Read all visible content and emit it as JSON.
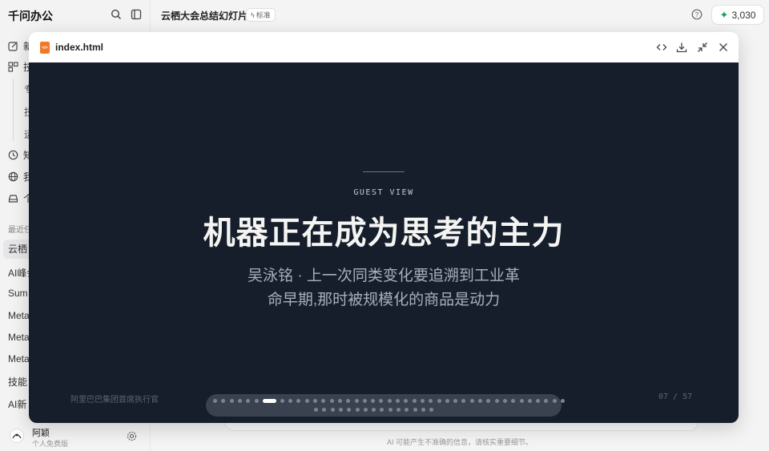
{
  "app": {
    "brand": "千问办公",
    "doc_title": "云栖大会总结幻灯片",
    "doc_tag": "标准",
    "credits": "3,030",
    "disclaimer": "AI 可能产生不准确的信息，请核实重要细节。"
  },
  "sidebar": {
    "nav": [
      "新",
      "技",
      "知",
      "我",
      "个"
    ],
    "sub_items": [
      "专",
      "技",
      "运"
    ],
    "section_label": "最近任",
    "recent": [
      "云栖",
      "AI峰会",
      "Sum",
      "Meta",
      "Meta",
      "Meta",
      "技能",
      "AI新"
    ],
    "user": {
      "name": "阿颖",
      "plan": "个人免费版"
    }
  },
  "preview": {
    "file_name": "index.html",
    "file_badge": "</>",
    "icons": [
      "code-view-icon",
      "download-icon",
      "collapse-icon",
      "close-icon"
    ]
  },
  "slide": {
    "kicker": "GUEST VIEW",
    "headline": "机器正在成为思考的主力",
    "quote_line1": "吴泳铭 · 上一次同类变化要追溯到工业革",
    "quote_line2": "命早期,那时被规模化的商品是动力",
    "speaker_role": "阿里巴巴集团首席执行官",
    "page_current": "07",
    "page_total": "57",
    "page_indicator": "07 / 57",
    "total_slides": 57,
    "active_slide_index": 7
  }
}
